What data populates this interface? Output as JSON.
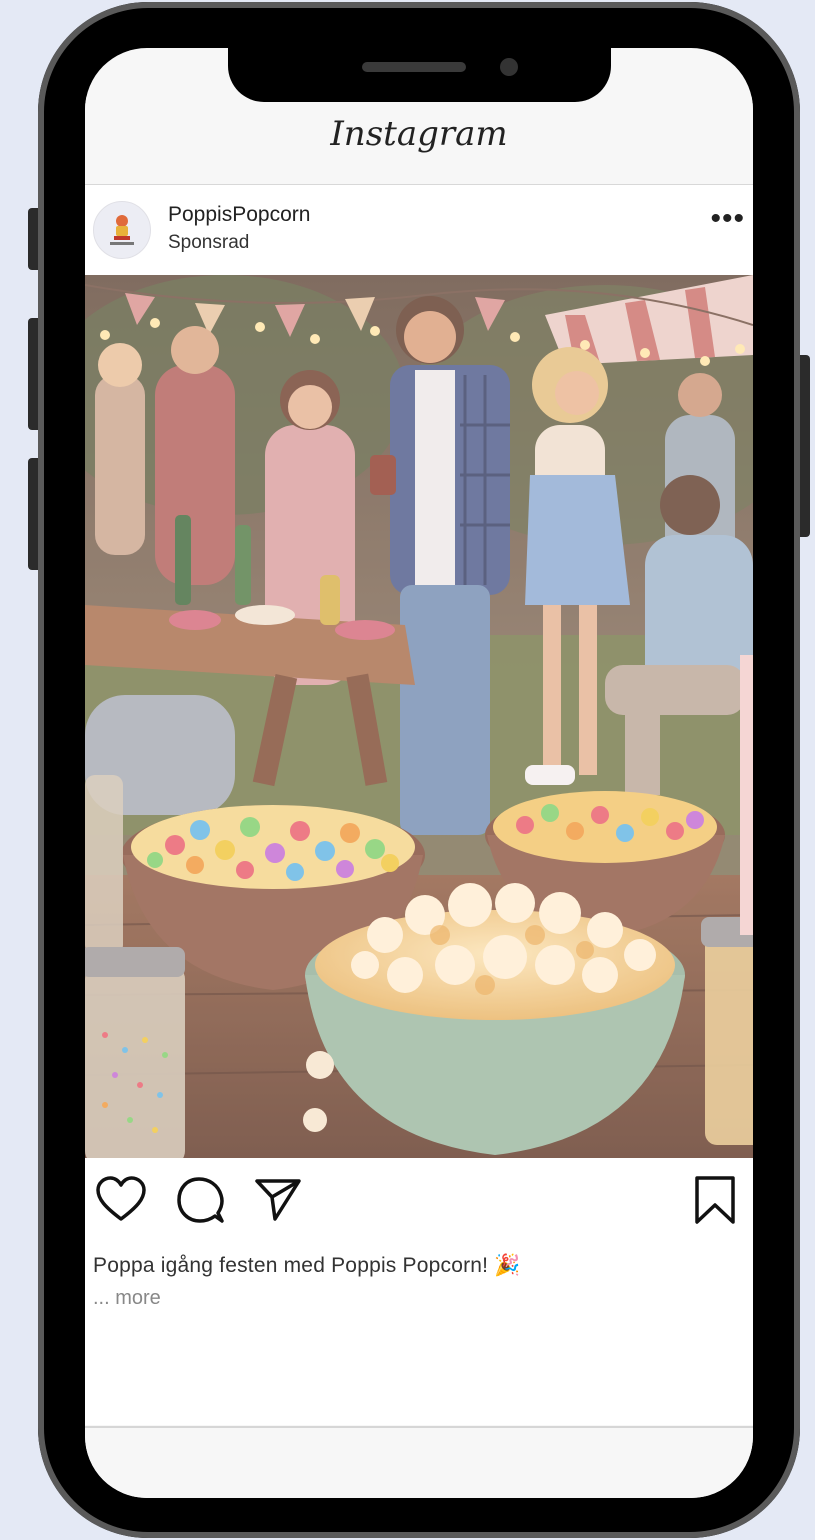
{
  "header": {
    "title": "Instagram"
  },
  "post": {
    "username": "PoppisPopcorn",
    "subtitle": "Sponsrad",
    "options_icon": "more-horizontal-icon",
    "caption": "Poppa igång festen med Poppis Popcorn!",
    "caption_emoji": "🎉",
    "more_label": "... more",
    "actions": [
      "heart-icon",
      "comment-icon",
      "share-icon",
      "bookmark-icon"
    ]
  }
}
